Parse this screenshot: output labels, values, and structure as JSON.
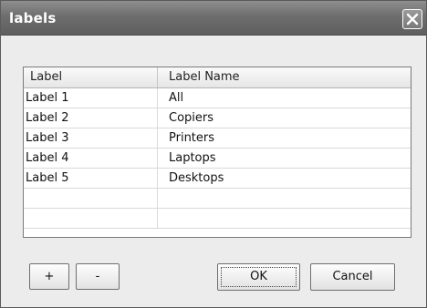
{
  "window": {
    "title": "labels",
    "close_icon": "close-icon"
  },
  "list": {
    "columns": [
      "Label",
      "Label Name"
    ],
    "rows": [
      [
        "Label 1",
        "All"
      ],
      [
        "Label 2",
        "Copiers"
      ],
      [
        "Label 3",
        "Printers"
      ],
      [
        "Label 4",
        "Laptops"
      ],
      [
        "Label 5",
        "Desktops"
      ],
      [
        "",
        ""
      ],
      [
        "",
        ""
      ]
    ]
  },
  "buttons": {
    "add": "+",
    "remove": "-",
    "ok": "OK",
    "cancel": "Cancel"
  }
}
